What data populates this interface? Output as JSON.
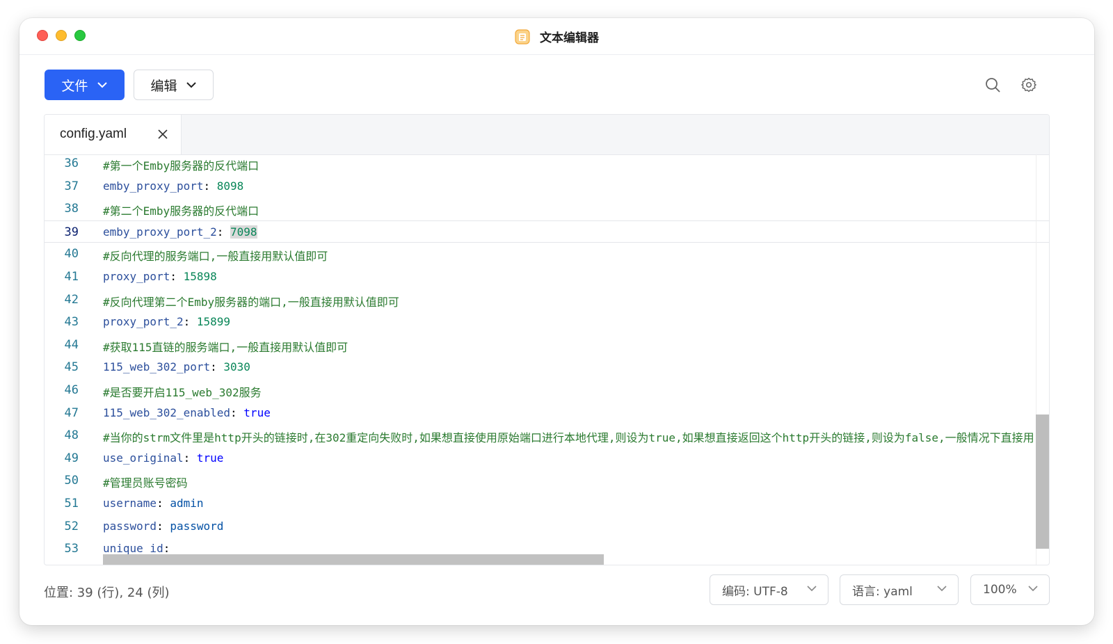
{
  "window": {
    "title": "文本编辑器",
    "accent_color": "#2a63f5"
  },
  "toolbar": {
    "file_label": "文件",
    "edit_label": "编辑",
    "search_icon": "search-icon",
    "settings_icon": "gear-icon"
  },
  "tabs": [
    {
      "label": "config.yaml"
    }
  ],
  "editor": {
    "active_line": 39,
    "lines": [
      {
        "num": "36",
        "kind": "comment",
        "text": "#第一个Emby服务器的反代端口"
      },
      {
        "num": "37",
        "kind": "kv",
        "key": "emby_proxy_port",
        "value": "8098",
        "vtype": "n"
      },
      {
        "num": "38",
        "kind": "comment",
        "text": "#第二个Emby服务器的反代端口"
      },
      {
        "num": "39",
        "kind": "kv",
        "key": "emby_proxy_port_2",
        "value": "7098",
        "vtype": "n",
        "selected": true
      },
      {
        "num": "40",
        "kind": "comment",
        "text": "#反向代理的服务端口,一般直接用默认值即可"
      },
      {
        "num": "41",
        "kind": "kv",
        "key": "proxy_port",
        "value": "15898",
        "vtype": "n"
      },
      {
        "num": "42",
        "kind": "comment",
        "text": "#反向代理第二个Emby服务器的端口,一般直接用默认值即可"
      },
      {
        "num": "43",
        "kind": "kv",
        "key": "proxy_port_2",
        "value": "15899",
        "vtype": "n"
      },
      {
        "num": "44",
        "kind": "comment",
        "text": "#获取115直链的服务端口,一般直接用默认值即可"
      },
      {
        "num": "45",
        "kind": "kv",
        "key": "115_web_302_port",
        "value": "3030",
        "vtype": "n"
      },
      {
        "num": "46",
        "kind": "comment",
        "text": "#是否要开启115_web_302服务"
      },
      {
        "num": "47",
        "kind": "kv",
        "key": "115_web_302_enabled",
        "value": "true",
        "vtype": "b"
      },
      {
        "num": "48",
        "kind": "comment",
        "text": "#当你的strm文件里是http开头的链接时,在302重定向失败时,如果想直接使用原始端口进行本地代理,则设为true,如果想直接返回这个http开头的链接,则设为false,一般情况下直接用"
      },
      {
        "num": "49",
        "kind": "kv",
        "key": "use_original",
        "value": "true",
        "vtype": "b"
      },
      {
        "num": "50",
        "kind": "comment",
        "text": "#管理员账号密码"
      },
      {
        "num": "51",
        "kind": "kv",
        "key": "username",
        "value": "admin",
        "vtype": "s"
      },
      {
        "num": "52",
        "kind": "kv",
        "key": "password",
        "value": "password",
        "vtype": "s"
      },
      {
        "num": "53",
        "kind": "kv",
        "key": "unique_id",
        "value": "",
        "vtype": "s"
      }
    ]
  },
  "status": {
    "position": "位置: 39 (行), 24 (列)",
    "encoding": "编码: UTF-8",
    "language": "语言: yaml",
    "zoom": "100%"
  }
}
